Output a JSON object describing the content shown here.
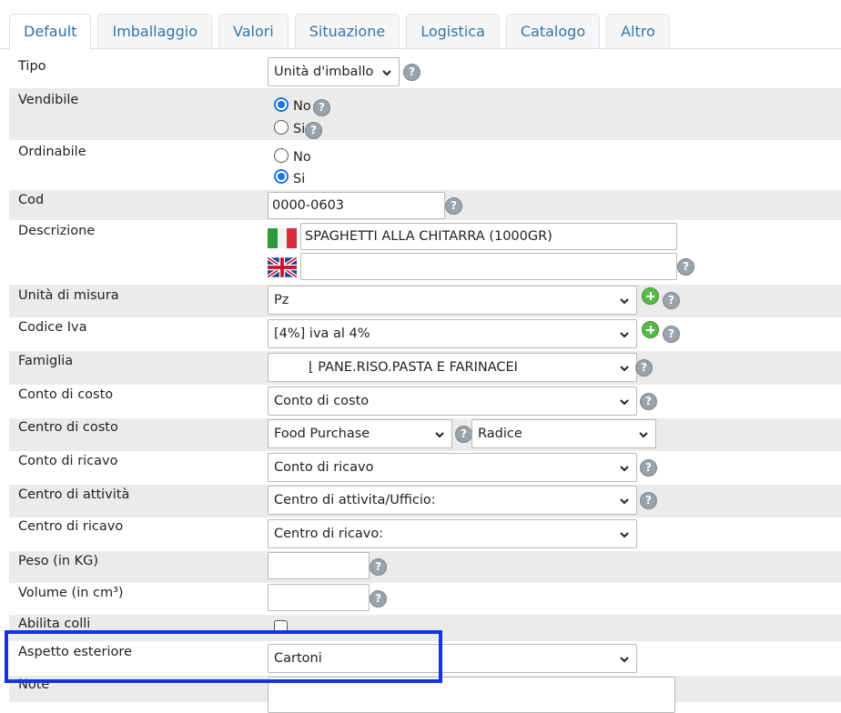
{
  "tabs": [
    "Default",
    "Imballaggio",
    "Valori",
    "Situazione",
    "Logistica",
    "Catalogo",
    "Altro"
  ],
  "form": {
    "tipo": {
      "label": "Tipo",
      "value": "Unità d'imballo"
    },
    "vendibile": {
      "label": "Vendibile",
      "options": [
        "No",
        "Si"
      ],
      "selected": "No"
    },
    "ordinabile": {
      "label": "Ordinabile",
      "options": [
        "No",
        "Si"
      ],
      "selected": "Si"
    },
    "cod": {
      "label": "Cod",
      "value": "0000-0603"
    },
    "descrizione": {
      "label": "Descrizione",
      "it_value": "SPAGHETTI ALLA CHITARRA (1000GR)",
      "en_value": ""
    },
    "unita_misura": {
      "label": "Unità di misura",
      "value": "Pz"
    },
    "codice_iva": {
      "label": "Codice Iva",
      "value": "[4%] iva al 4%"
    },
    "famiglia": {
      "label": "Famiglia",
      "value": "⌊ PANE.RISO.PASTA E FARINACEI"
    },
    "conto_costo": {
      "label": "Conto di costo",
      "value": "Conto di costo"
    },
    "centro_costo": {
      "label": "Centro di costo",
      "value": "Food Purchase",
      "value2": "Radice"
    },
    "conto_ricavo": {
      "label": "Conto di ricavo",
      "value": "Conto di ricavo"
    },
    "centro_attivita": {
      "label": "Centro di attività",
      "value": "Centro di attivita/Ufficio:"
    },
    "centro_ricavo": {
      "label": "Centro di ricavo",
      "value": "Centro di ricavo:"
    },
    "peso": {
      "label": "Peso (in KG)",
      "value": ""
    },
    "volume": {
      "label": "Volume (in cm³)",
      "value": ""
    },
    "abilita_colli": {
      "label": "Abilita colli",
      "checked": false
    },
    "aspetto_esteriore": {
      "label": "Aspetto esteriore",
      "value": "Cartoni"
    },
    "note": {
      "label": "Note",
      "value": ""
    }
  },
  "icons": {
    "help": "help-icon",
    "add": "add-icon",
    "chevron": "chevron-down-icon",
    "flag_it": "italy-flag-icon",
    "flag_uk": "uk-flag-icon"
  },
  "help_glyph": "?",
  "colors": {
    "tab_text": "#3b74a6",
    "row_shade": "#ebebeb",
    "highlight": "#1533e6",
    "radio": "#1a73e8",
    "add": "#59b84a"
  }
}
